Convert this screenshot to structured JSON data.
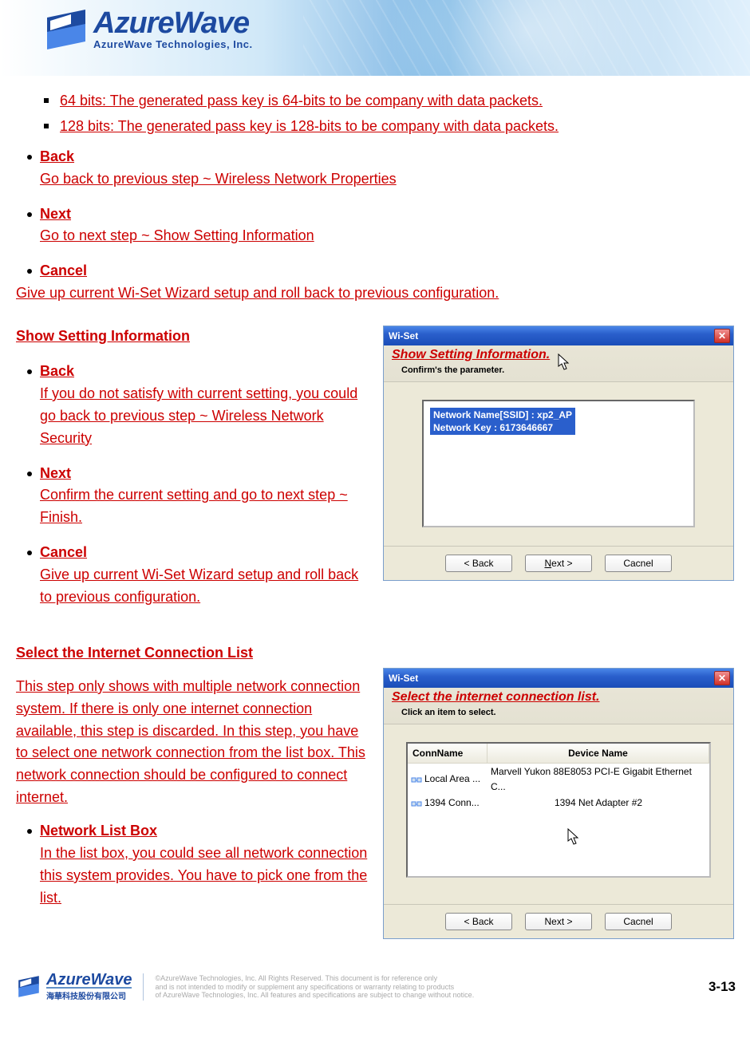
{
  "header": {
    "logo_main": "AzureWave",
    "logo_sub": "AzureWave  Technologies,  Inc."
  },
  "top_list": {
    "item1": "64 bits: The generated pass key is 64-bits to be company with data packets.",
    "item2": "128 bits: The generated pass key is 128-bits to be company with data packets."
  },
  "actions1": {
    "back": {
      "title": "Back",
      "desc": "Go back to previous step ~ Wireless Network Properties"
    },
    "next": {
      "title": "Next",
      "desc": "Go to next step ~ Show Setting Information"
    },
    "cancel": {
      "title": "Cancel",
      "desc": "Give up current Wi-Set Wizard setup and roll back to previous configuration."
    }
  },
  "section2": {
    "heading": "Show Setting Information",
    "back": {
      "title": "Back",
      "desc": "If you do not satisfy with current setting, you could go back to previous step ~ Wireless Network Security"
    },
    "next": {
      "title": "Next",
      "desc": "Confirm the current setting and go to next step ~ Finish."
    },
    "cancel": {
      "title": "Cancel",
      "desc": "Give up current Wi-Set Wizard setup and roll back to previous configuration. "
    }
  },
  "dialog1": {
    "title": "Wi-Set",
    "head": "Show Setting Information.",
    "sub": "Confirm's the parameter.",
    "line1": "Network Name[SSID] : xp2_AP",
    "line2": "Network Key : 6173646667",
    "btn_back": "< Back",
    "btn_next": "Next >",
    "btn_cancel": "Cacnel"
  },
  "section3": {
    "heading": " Select the Internet Connection List",
    "para": "This step only shows with multiple network connection system. If there is only one internet connection available, this step is discarded. In this step, you have to select one network connection from the list box. This network connection should be configured to connect internet.",
    "nlb": {
      "title": "Network List Box",
      "desc": "In the list box, you could see all network connection this system provides. You have to pick one from the list."
    }
  },
  "dialog2": {
    "title": "Wi-Set",
    "head": "Select the internet connection list.",
    "sub": "Click an item to select.",
    "col1": "ConnName",
    "col2": "Device Name",
    "rows": [
      {
        "conn": "Local Area ...",
        "dev": "Marvell Yukon 88E8053 PCI-E Gigabit Ethernet C..."
      },
      {
        "conn": "1394 Conn...",
        "dev": "1394 Net Adapter #2"
      }
    ],
    "btn_back": "< Back",
    "btn_next": "Next >",
    "btn_cancel": "Cacnel"
  },
  "footer": {
    "logo_main": "AzureWave",
    "logo_sub": "海華科技股份有限公司",
    "disclaimer1": "©AzureWave Technologies, Inc. All Rights Reserved. This document is for reference only",
    "disclaimer2": "and is not intended to modify or supplement any specifications or  warranty relating to products",
    "disclaimer3": "of AzureWave Technologies, Inc.  All features and specifications are subject to change without notice.",
    "pagenum": "3-13"
  }
}
